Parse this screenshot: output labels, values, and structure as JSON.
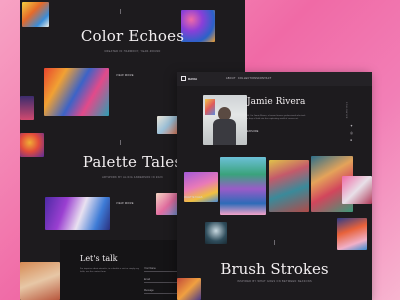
{
  "back_page": {
    "section1": {
      "title": "Color Echoes",
      "subtitle": "CREATED IN HARMONY, YEAR-ROUND",
      "view_more": "VIEW MORE"
    },
    "section2": {
      "title": "Palette Tales",
      "subtitle": "ARTWORK BY ALICIA ANDERSON IN 2023",
      "view_more": "VIEW MORE"
    },
    "contact": {
      "title": "Let's talk",
      "text": "For inquiries about artworks, to schedule a visit or simply say hello, use the contact form.",
      "fields": [
        "Your Name",
        "Email",
        "Message"
      ]
    }
  },
  "front_page": {
    "nav": {
      "brand": "RAVIA",
      "items": [
        "ABOUT",
        "COLLECTIONS",
        "CONTACT"
      ]
    },
    "profile": {
      "name": "Jamie Rivera",
      "bio": "Hi, I'm Jamie Rivera, a former finance professional who took a leap of faith into the captivating world of canvas art.",
      "link": "EXPLORE",
      "vertical_label": "FOLLOW ME",
      "social_icons": [
        "twitter-icon",
        "instagram-icon",
        "behance-icon"
      ]
    },
    "gallery_caption": "PALETTE TALES",
    "brush_section": {
      "title": "Brush Strokes",
      "subtitle": "INSPIRED BY WHAT GOES ON BETWEEN SEASONS"
    }
  },
  "colors": {
    "background_pink": "#f06aa6",
    "page_dark": "#1d1b1e",
    "text_light": "#f2eef0",
    "text_muted": "#8c8890"
  }
}
